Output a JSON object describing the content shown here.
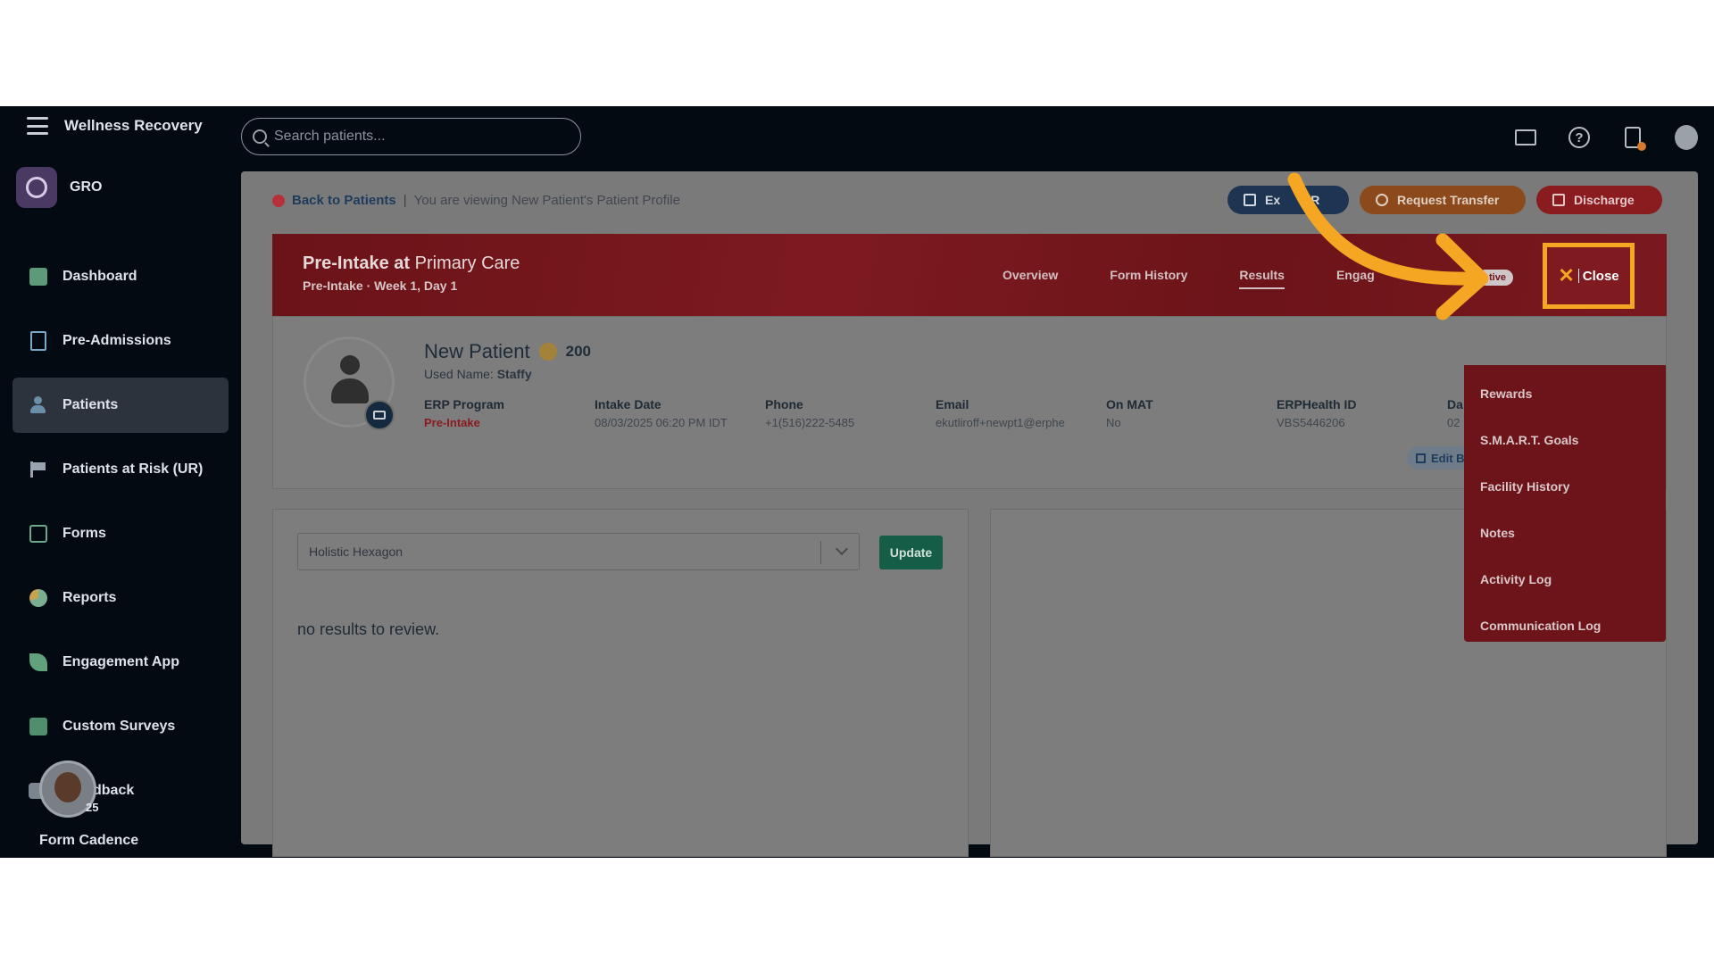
{
  "app": {
    "name": "Wellness Recovery",
    "org": "GRO"
  },
  "search": {
    "placeholder": "Search patients..."
  },
  "sidebar": {
    "items": [
      {
        "label": "Dashboard",
        "icon": "dashboard-icon"
      },
      {
        "label": "Pre-Admissions",
        "icon": "pre-admissions-icon"
      },
      {
        "label": "Patients",
        "icon": "patients-icon",
        "active": true
      },
      {
        "label": "Patients at Risk (UR)",
        "icon": "flag-icon"
      },
      {
        "label": "Forms",
        "icon": "forms-icon"
      },
      {
        "label": "Reports",
        "icon": "reports-icon"
      },
      {
        "label": "Engagement App",
        "icon": "leaf-icon"
      },
      {
        "label": "Custom Surveys",
        "icon": "survey-icon"
      },
      {
        "label": "dback",
        "icon": "feedback-icon"
      }
    ],
    "cadence": {
      "count": "25",
      "label": "Form Cadence"
    }
  },
  "breadcrumb": {
    "back": "Back to Patients",
    "separator": "|",
    "context": "You are viewing New Patient's Patient Profile"
  },
  "actions": {
    "export": "Ex",
    "export_tail": "UR",
    "transfer": "Request Transfer",
    "discharge": "Discharge"
  },
  "header": {
    "title_bold": "Pre-Intake at",
    "title_rest": "Primary Care",
    "subtitle": "Pre-Intake · Week 1, Day 1",
    "tabs": [
      {
        "label": "Overview"
      },
      {
        "label": "Form History"
      },
      {
        "label": "Results",
        "active": true
      },
      {
        "label": "Engag"
      }
    ],
    "status_badge": "tive",
    "close": "Close"
  },
  "patient": {
    "name": "New Patient",
    "points": "200",
    "used_name_label": "Used Name:",
    "used_name": "Staffy",
    "fields": [
      {
        "label": "ERP Program",
        "value": "Pre-Intake",
        "highlight": true
      },
      {
        "label": "Intake Date",
        "value": "08/03/2025 06:20 PM IDT"
      },
      {
        "label": "Phone",
        "value": "+1(516)222-5485"
      },
      {
        "label": "Email",
        "value": "ekutliroff+newpt1@erphe"
      },
      {
        "label": "On MAT",
        "value": "No"
      },
      {
        "label": "ERPHealth ID",
        "value": "VBS5446206"
      },
      {
        "label": "Da",
        "value": "02"
      }
    ],
    "edit": "Edit B"
  },
  "menu": {
    "items": [
      "Rewards",
      "S.M.A.R.T. Goals",
      "Facility History",
      "Notes",
      "Activity Log",
      "Communication Log"
    ]
  },
  "results": {
    "select_value": "Holistic Hexagon",
    "update": "Update",
    "empty": "no results to review."
  },
  "colors": {
    "accent_red": "#8a1b1f",
    "highlight": "#f5a623",
    "update_green": "#155d47"
  }
}
